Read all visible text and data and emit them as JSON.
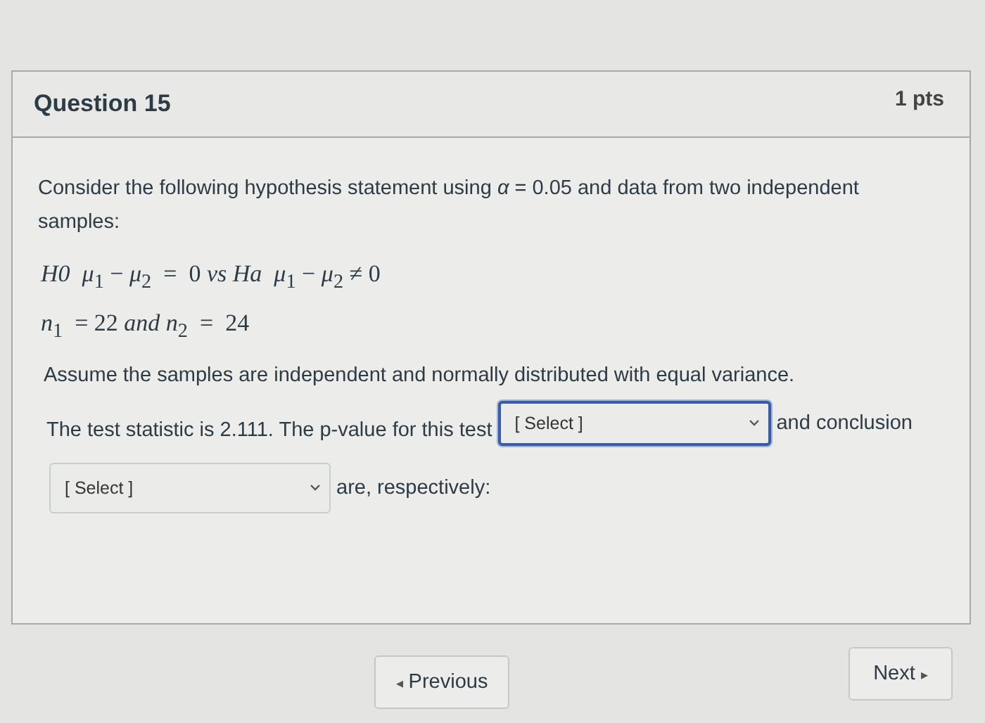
{
  "question": {
    "title": "Question 15",
    "points": "1 pts"
  },
  "body": {
    "intro": "Consider the following hypothesis statement using *α* = 0.05 and data from two independent samples:",
    "math_lines": [
      "*H0*  *μ*$_{1}$ − *μ*$_{2}$  =  0 *vs Ha*  *μ*$_{1}$ − *μ*$_{2}$ ≠ 0",
      "*n*$_{1}$  = 22 *and n*$_{2}$  =  24"
    ],
    "assumption": "Assume the samples are independent and normally distributed with equal variance.",
    "sentence_1": "The test statistic is 2.111. The p-value for this test",
    "dropdown_1": {
      "value": "[ Select ]",
      "focused": true
    },
    "sentence_2": "and conclusion",
    "dropdown_2": {
      "value": "[ Select ]",
      "focused": false
    },
    "sentence_3": "are, respectively:"
  },
  "nav": {
    "previous": {
      "arrow": "◂",
      "label": "Previous"
    },
    "next": {
      "label": "Next",
      "arrow": "▸"
    }
  }
}
